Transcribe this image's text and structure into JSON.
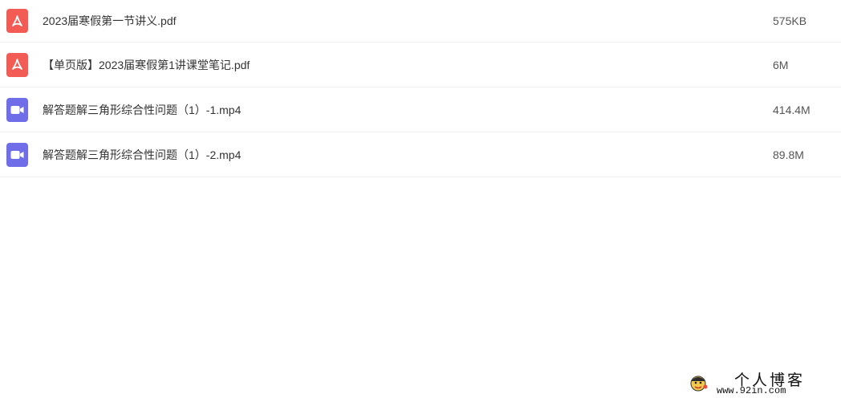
{
  "files": [
    {
      "type": "pdf",
      "icon": "pdf-icon",
      "name": "2023届寒假第一节讲义.pdf",
      "size": "575KB"
    },
    {
      "type": "pdf",
      "icon": "pdf-icon",
      "name": "【单页版】2023届寒假第1讲课堂笔记.pdf",
      "size": "6M"
    },
    {
      "type": "video",
      "icon": "video-icon",
      "name": "解答题解三角形综合性问题（1）-1.mp4",
      "size": "414.4M"
    },
    {
      "type": "video",
      "icon": "video-icon",
      "name": "解答题解三角形综合性问题（1）-2.mp4",
      "size": "89.8M"
    }
  ],
  "watermark": {
    "title": "个人博客",
    "url": "www.92in.com"
  },
  "colors": {
    "pdf_icon": "#f25c54",
    "video_icon": "#6f6ee8",
    "row_divider": "#eef0f3"
  }
}
